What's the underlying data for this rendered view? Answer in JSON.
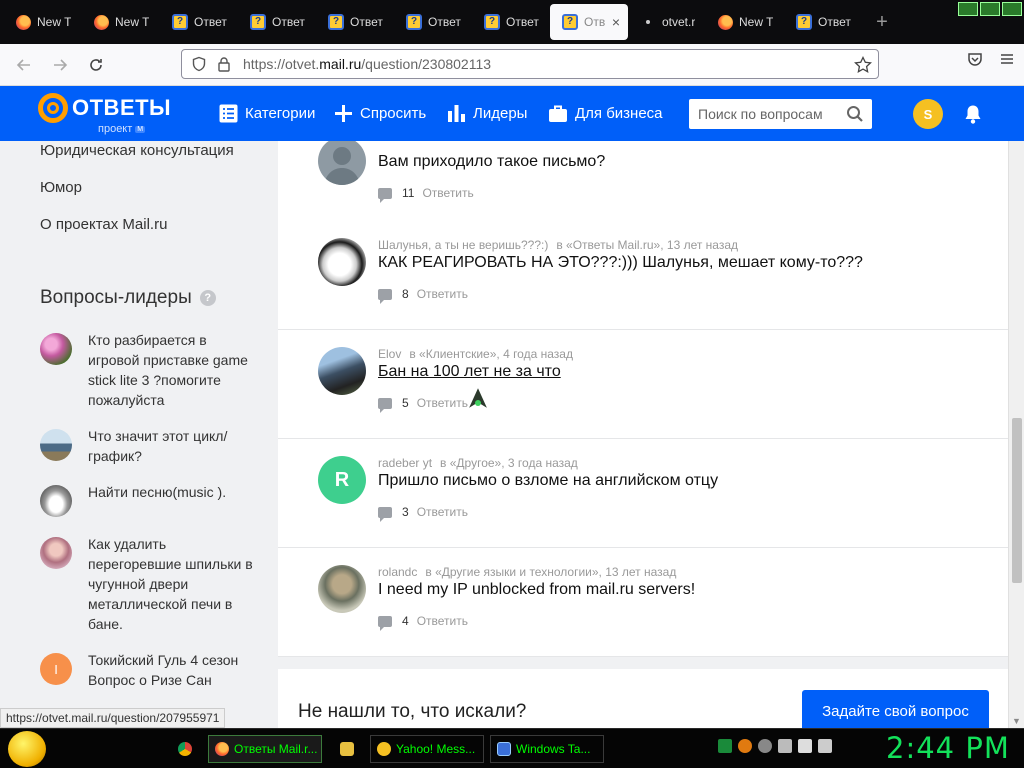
{
  "browser": {
    "tabs": [
      {
        "title": "New T",
        "icon": "firefox-icon",
        "active": false
      },
      {
        "title": "New T",
        "icon": "firefox-icon",
        "active": false
      },
      {
        "title": "Ответ",
        "icon": "otvety-icon",
        "active": false
      },
      {
        "title": "Ответ",
        "icon": "otvety-icon",
        "active": false
      },
      {
        "title": "Ответ",
        "icon": "otvety-icon",
        "active": false
      },
      {
        "title": "Ответ",
        "icon": "otvety-icon",
        "active": false
      },
      {
        "title": "Ответ",
        "icon": "otvety-icon",
        "active": false
      },
      {
        "title": "Отв",
        "icon": "otvety-icon",
        "active": true
      },
      {
        "title": "otvet.r",
        "icon": "dot-icon",
        "active": false
      },
      {
        "title": "New T",
        "icon": "firefox-icon",
        "active": false
      },
      {
        "title": "Ответ",
        "icon": "otvety-icon",
        "active": false
      }
    ],
    "close_glyph": "×",
    "newtab_glyph": "+",
    "url_prefix": "https://otvet.",
    "url_host": "mail.ru",
    "url_path": "/question/230802113"
  },
  "header": {
    "logo_text": "ОТВЕТЫ",
    "logo_sub": "проект",
    "logo_badge": "М",
    "nav": [
      {
        "label": "Категории",
        "icon": "list-icon"
      },
      {
        "label": "Спросить",
        "icon": "plus-icon"
      },
      {
        "label": "Лидеры",
        "icon": "bar-chart-icon"
      },
      {
        "label": "Для бизнеса",
        "icon": "briefcase-icon"
      }
    ],
    "search_placeholder": "Поиск по вопросам",
    "avatar_letter": "S"
  },
  "sidebar": {
    "links": [
      "Юридическая консультация",
      "Юмор",
      "О проектах Mail.ru"
    ],
    "leaders_heading": "Вопросы-лидеры",
    "help_glyph": "?",
    "leaders": [
      {
        "text": "Кто разбирается в игровой приставке game stick lite 3 ?помогите пожалуйста",
        "pic": "flowers"
      },
      {
        "text": "Что значит этот цикл/график?",
        "pic": "landscape"
      },
      {
        "text": "Найти песню(music ).",
        "pic": "car"
      },
      {
        "text": "Как удалить перегоревшие шпильки в чугунной двери металлической печи в бане.",
        "pic": "portrait"
      },
      {
        "text": "Токийский Гуль 4 сезон Вопрос о Ризе Сан",
        "pic": "letter",
        "letter": "I"
      }
    ]
  },
  "feed": {
    "questions": [
      {
        "author": "",
        "category": "",
        "ago": "",
        "title": "Вам приходило такое письмо?",
        "answers": "11",
        "reply": "Ответить",
        "avatar": "default",
        "underline": false
      },
      {
        "author": "Шалунья, а ты не веришь???:)",
        "category": "в «Ответы Mail.ru»,",
        "ago": "13 лет назад",
        "title": "КАК РЕАГИРОВАТЬ НА ЭТО???:))) Шалунья, мешает кому-то???",
        "answers": "8",
        "reply": "Ответить",
        "avatar": "cat",
        "underline": false
      },
      {
        "author": "Elov",
        "category": "в «Клиентские»,",
        "ago": "4 года назад",
        "title": "Бан на 100 лет не за что",
        "answers": "5",
        "reply": "Ответить",
        "avatar": "rock",
        "underline": true
      },
      {
        "author": "radeber yt",
        "category": "в «Другое»,",
        "ago": "3 года назад",
        "title": "Пришло письмо о взломе на английском отцу",
        "answers": "3",
        "reply": "Ответить",
        "avatar": "letter",
        "letter": "R",
        "underline": false
      },
      {
        "author": "rolandc",
        "category": "в «Другие языки и технологии»,",
        "ago": "13 лет назад",
        "title": "I need my IP unblocked from mail.ru servers!",
        "answers": "4",
        "reply": "Ответить",
        "avatar": "man",
        "underline": false
      }
    ],
    "not_found_text": "Не нашли то, что искали?",
    "ask_button": "Задайте свой вопрос"
  },
  "status_url": "https://otvet.mail.ru/question/207955971",
  "taskbar": {
    "items": [
      {
        "label": "",
        "icon": "chrome-icon"
      },
      {
        "label": "Ответы Mail.r...",
        "icon": "firefox-icon",
        "active": true
      },
      {
        "label": "",
        "icon": "folder-icon"
      },
      {
        "label": "Yahoo! Mess...",
        "icon": "yahoo-messenger-icon"
      },
      {
        "label": "Windows Ta...",
        "icon": "task-manager-icon"
      }
    ],
    "clock": "2:44 PM"
  },
  "colors": {
    "brand_blue": "#005ff9",
    "logo_orange": "#ff9e00",
    "clock_green": "#13e25a"
  }
}
